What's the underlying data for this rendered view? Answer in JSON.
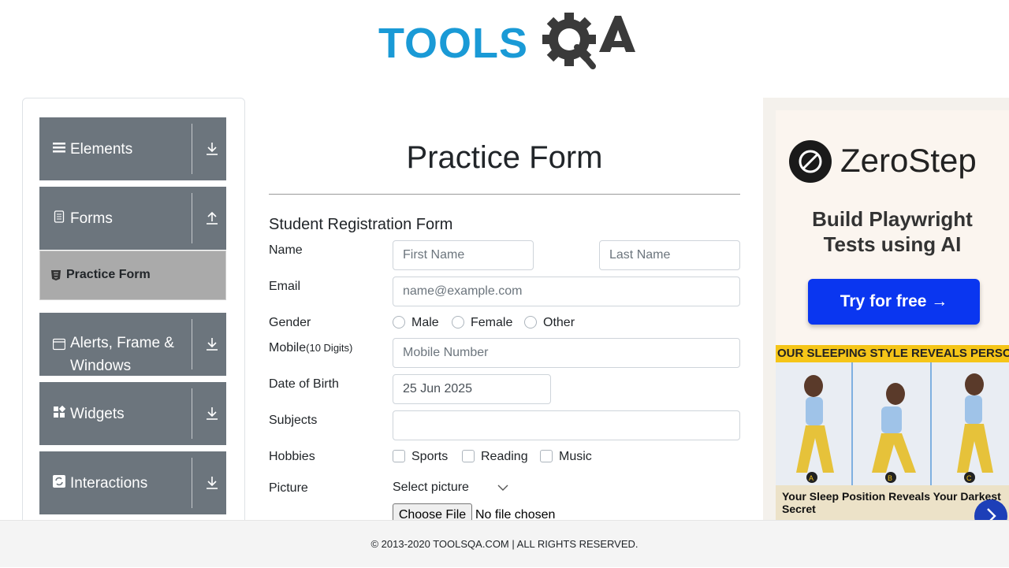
{
  "logo": {
    "text_tools": "TOOLS",
    "text_qa": "QA"
  },
  "sidebar": {
    "groups": [
      {
        "label": "Elements",
        "icon": "menu-icon",
        "arrow": "download-icon"
      },
      {
        "label": "Forms",
        "icon": "document-icon",
        "arrow": "upload-icon"
      },
      {
        "label": "Alerts, Frame & Windows",
        "icon": "window-icon",
        "arrow": "download-icon"
      },
      {
        "label": "Widgets",
        "icon": "widgets-icon",
        "arrow": "download-icon"
      },
      {
        "label": "Interactions",
        "icon": "interactions-icon",
        "arrow": "download-icon"
      }
    ],
    "active_item": {
      "label": "Practice Form",
      "icon": "html5-icon"
    }
  },
  "form": {
    "title": "Practice Form",
    "subtitle": "Student Registration Form",
    "name_label": "Name",
    "first_name_placeholder": "First Name",
    "last_name_placeholder": "Last Name",
    "email_label": "Email",
    "email_placeholder": "name@example.com",
    "gender_label": "Gender",
    "gender_options": [
      "Male",
      "Female",
      "Other"
    ],
    "mobile_label": "Mobile",
    "mobile_hint": "(10 Digits)",
    "mobile_placeholder": "Mobile Number",
    "dob_label": "Date of Birth",
    "dob_value": "25 Jun 2025",
    "subjects_label": "Subjects",
    "hobbies_label": "Hobbies",
    "hobby_options": [
      "Sports",
      "Reading",
      "Music"
    ],
    "picture_label": "Picture",
    "select_picture": "Select picture",
    "choose_file": "Choose File",
    "no_file": "No file chosen"
  },
  "ad": {
    "brand": "ZeroStep",
    "tagline_line1": "Build Playwright",
    "tagline_line2": "Tests using AI",
    "cta": "Try for free →",
    "ad2_headline": "OUR SLEEPING STYLE REVEALS PERSONALIT",
    "ad2_caption": "Your Sleep Position Reveals Your Darkest Secret",
    "ad2_panels": [
      "A",
      "B",
      "C"
    ]
  },
  "footer": {
    "text": "© 2013-2020 TOOLSQA.COM | ALL RIGHTS RESERVED."
  },
  "colors": {
    "logo_blue": "#1a9ad6",
    "sidebar_gray": "#6c757d",
    "active_gray": "#aaaaaa",
    "cta_blue": "#0a36f0"
  }
}
